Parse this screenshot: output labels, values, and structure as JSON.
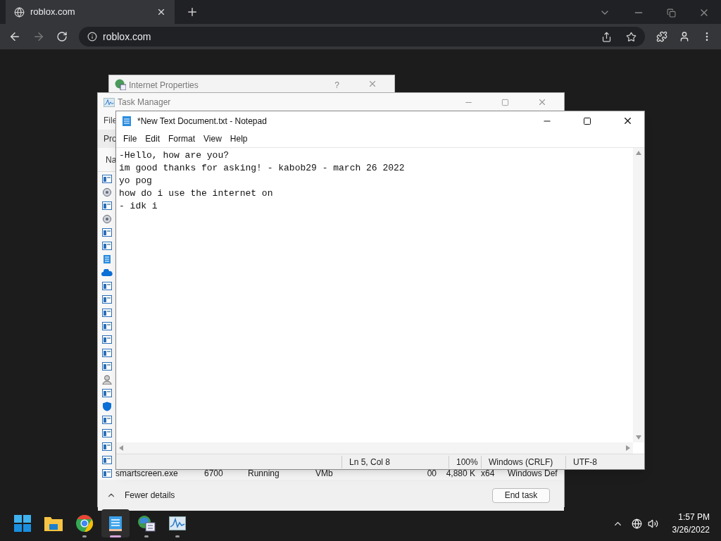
{
  "browser": {
    "tab": {
      "title": "roblox.com",
      "selected": true
    },
    "address": "roblox.com"
  },
  "internet_properties": {
    "title": "Internet Properties",
    "help": "?"
  },
  "task_manager": {
    "title": "Task Manager",
    "menu": "File",
    "tab": "Pro",
    "column": "Na",
    "rows": [
      {
        "kind": "app"
      },
      {
        "kind": "gear"
      },
      {
        "kind": "app"
      },
      {
        "kind": "gear"
      },
      {
        "kind": "app"
      },
      {
        "kind": "app"
      },
      {
        "kind": "notepad"
      },
      {
        "kind": "cloud"
      },
      {
        "kind": "app"
      },
      {
        "kind": "app"
      },
      {
        "kind": "app"
      },
      {
        "kind": "app"
      },
      {
        "kind": "app"
      },
      {
        "kind": "app"
      },
      {
        "kind": "app"
      },
      {
        "kind": "person"
      },
      {
        "kind": "app"
      },
      {
        "kind": "shield"
      },
      {
        "kind": "app"
      },
      {
        "kind": "app"
      },
      {
        "kind": "app"
      },
      {
        "kind": "app"
      }
    ],
    "last_row": {
      "kind": "app",
      "cells": [
        "smartscreen.exe",
        "6700",
        "Running",
        "VMb",
        "00",
        "4,880 K",
        "x64",
        "Windows Def"
      ]
    },
    "fewer_details": "Fewer details",
    "end_task": "End task"
  },
  "notepad": {
    "title": "*New Text Document.txt - Notepad",
    "menu": [
      "File",
      "Edit",
      "Format",
      "View",
      "Help"
    ],
    "lines": [
      "-Hello, how are you?",
      "im good thanks for asking! - kabob29 - march 26 2022",
      "yo pog",
      "how do i use the internet on",
      "- idk i"
    ],
    "status": [
      "Ln 5, Col 8",
      "100%",
      "Windows (CRLF)",
      "UTF-8"
    ]
  },
  "taskbar": {
    "apps": [
      {
        "kind": "start",
        "running": false,
        "selected": false
      },
      {
        "kind": "folder",
        "running": false,
        "selected": false
      },
      {
        "kind": "chrome",
        "running": true,
        "selected": false
      },
      {
        "kind": "notepad",
        "running": true,
        "selected": true
      },
      {
        "kind": "inetprops",
        "running": true,
        "selected": false
      },
      {
        "kind": "taskmgr",
        "running": true,
        "selected": false
      }
    ],
    "time": "1:57 PM",
    "date": "3/26/2022"
  }
}
